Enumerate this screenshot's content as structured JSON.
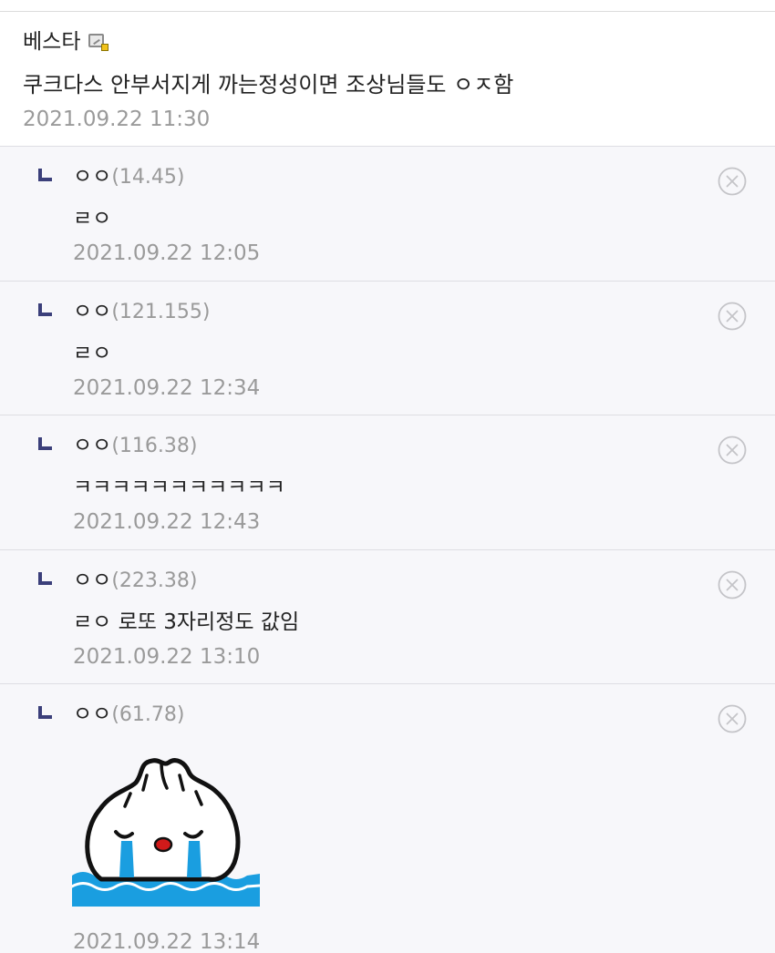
{
  "main_comment": {
    "author": "베스타",
    "author_icon": "gallog-icon",
    "text": "쿠크다스 안부서지게 까는정성이면 조상님들도 ㅇㅈ함",
    "date": "2021.09.22 11:30"
  },
  "replies": [
    {
      "name": "ㅇㅇ",
      "ip": "(14.45)",
      "text": "ㄹㅇ",
      "date": "2021.09.22 12:05"
    },
    {
      "name": "ㅇㅇ",
      "ip": "(121.155)",
      "text": "ㄹㅇ",
      "date": "2021.09.22 12:34"
    },
    {
      "name": "ㅇㅇ",
      "ip": "(116.38)",
      "text": "ㅋㅋㅋㅋㅋㅋㅋㅋㅋㅋㅋ",
      "date": "2021.09.22 12:43"
    },
    {
      "name": "ㅇㅇ",
      "ip": "(223.38)",
      "text": "ㄹㅇ 로또 3자리정도 값임",
      "date": "2021.09.22 13:10"
    },
    {
      "name": "ㅇㅇ",
      "ip": "(61.78)",
      "dccon": "crying-dumpling-sticker",
      "date": "2021.09.22 13:14"
    }
  ],
  "icons": {
    "reply_arrow": "reply-arrow-icon",
    "delete": "delete-circle-x-icon"
  },
  "colors": {
    "reply_background": "#f7f7fa",
    "reply_arrow": "#3b3f7a",
    "muted_text": "#9a9a9a",
    "water_blue": "#1a9ee0"
  }
}
